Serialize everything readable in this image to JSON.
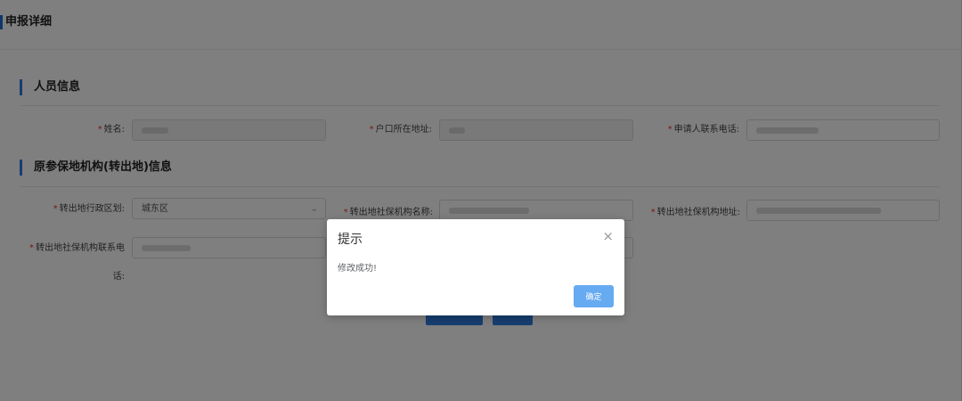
{
  "page": {
    "title": "申报详细"
  },
  "sections": {
    "personal": {
      "title": "人员信息"
    },
    "origin": {
      "title": "原参保地机构(转出地)信息"
    }
  },
  "fields": {
    "name": {
      "label": "姓名:"
    },
    "hukou_address": {
      "label": "户口所在地址:"
    },
    "applicant_phone": {
      "label": "申请人联系电话:"
    },
    "out_region": {
      "label": "转出地行政区划:",
      "value": "城东区"
    },
    "out_agency_name": {
      "label": "转出地社保机构名称:"
    },
    "out_agency_address": {
      "label": "转出地社保机构地址:"
    },
    "out_agency_phone": {
      "label_line1": "转出地社保机构联系电",
      "label_line2": "话:"
    }
  },
  "dialog": {
    "title": "提示",
    "close_glyph": "×",
    "message": "修改成功!",
    "ok_label": "确定"
  }
}
